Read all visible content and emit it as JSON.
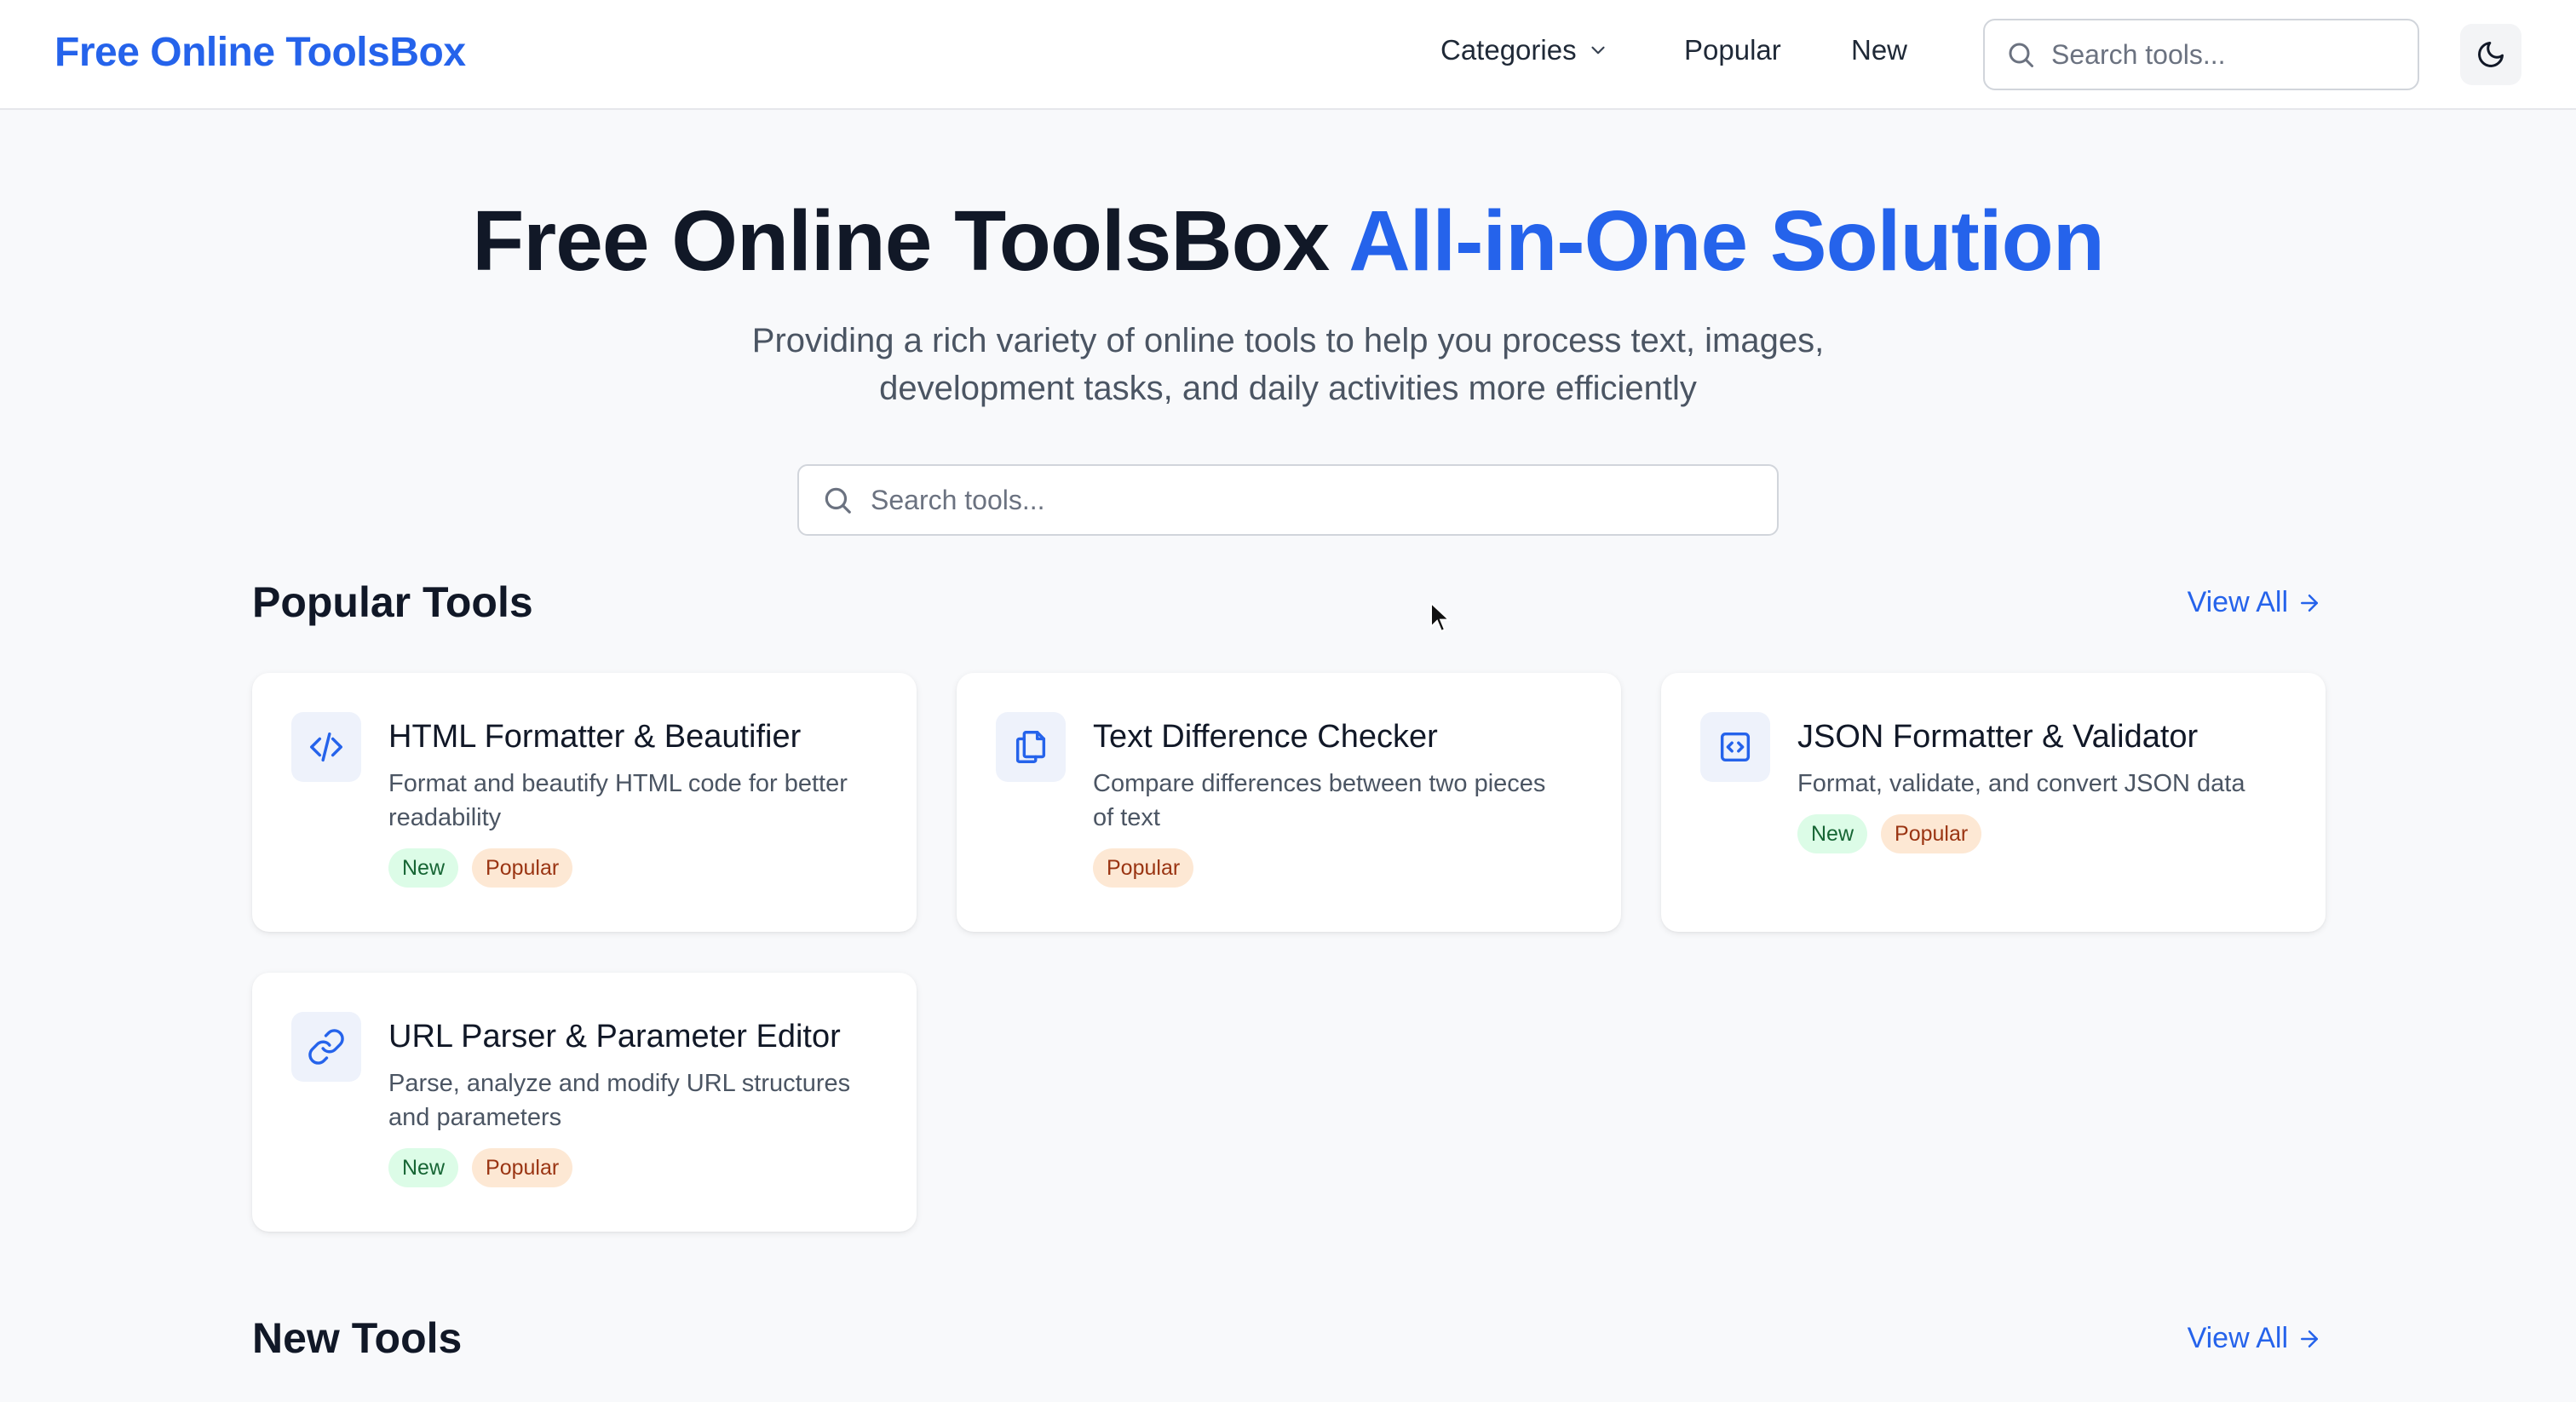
{
  "header": {
    "brand": "Free Online ToolsBox",
    "nav": {
      "categories": "Categories",
      "popular": "Popular",
      "new": "New"
    },
    "search_placeholder": "Search tools...",
    "theme_icon": "moon-icon"
  },
  "hero": {
    "title_main": "Free Online ToolsBox ",
    "title_accent": "All-in-One Solution",
    "subtitle_line1": "Providing a rich variety of online tools to help you process text, images,",
    "subtitle_line2": "development tasks, and daily activities more efficiently",
    "search_placeholder": "Search tools..."
  },
  "popular_section": {
    "title": "Popular Tools",
    "view_all": "View All",
    "cards": [
      {
        "icon": "code-icon",
        "title": "HTML Formatter & Beautifier",
        "desc_line1": "Format and beautify HTML code for better",
        "desc_line2": "readability",
        "tags": [
          "New",
          "Popular"
        ]
      },
      {
        "icon": "copy-icon",
        "title": "Text Difference Checker",
        "desc_line1": "Compare differences between two pieces",
        "desc_line2": "of text",
        "tags": [
          "Popular"
        ]
      },
      {
        "icon": "code-square-icon",
        "title": "JSON Formatter & Validator",
        "desc_line1": "Format, validate, and convert JSON data",
        "desc_line2": "",
        "tags": [
          "New",
          "Popular"
        ]
      },
      {
        "icon": "link-icon",
        "title": "URL Parser & Parameter Editor",
        "desc_line1": "Parse, analyze and modify URL structures",
        "desc_line2": "and parameters",
        "tags": [
          "New",
          "Popular"
        ]
      }
    ]
  },
  "new_section": {
    "title": "New Tools",
    "view_all": "View All"
  },
  "colors": {
    "brand": "#2563eb",
    "tag_new_bg": "#dcfce7",
    "tag_popular_bg": "#fde8d4"
  }
}
